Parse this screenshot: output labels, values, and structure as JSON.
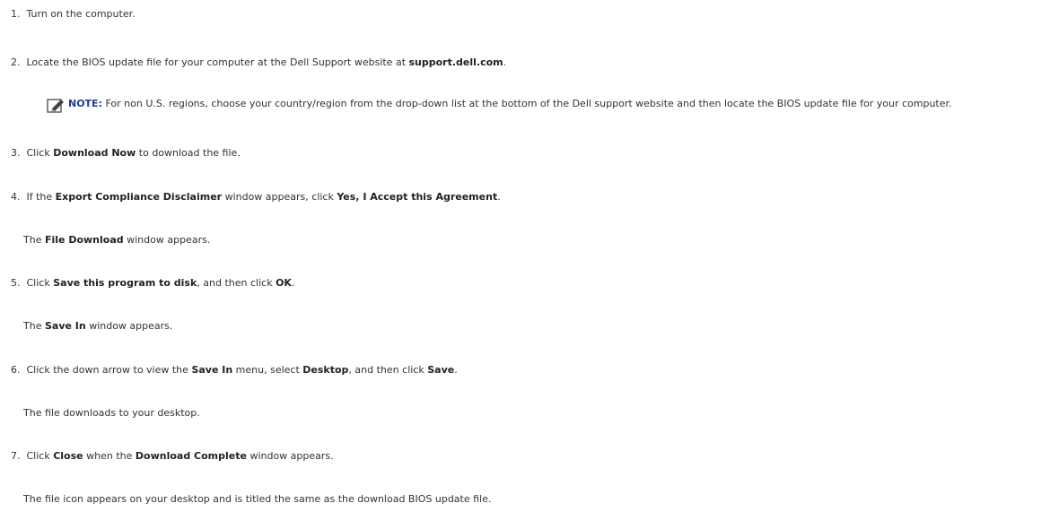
{
  "steps": {
    "s1": {
      "num": "1.",
      "text": "Turn on the computer."
    },
    "s2": {
      "num": "2.",
      "text_a": "Locate the BIOS update file for your computer at the Dell Support website at ",
      "bold_a": "support.dell.com",
      "text_b": "."
    },
    "note": {
      "label": "NOTE:",
      "text": " For non U.S. regions, choose your country/region from the drop-down list at the bottom of the Dell support website and then locate the BIOS update file for your computer."
    },
    "s3": {
      "num": "3.",
      "text_a": "Click ",
      "bold_a": "Download Now",
      "text_b": " to download the file."
    },
    "s4": {
      "num": "4.",
      "text_a": "If the ",
      "bold_a": "Export Compliance Disclaimer",
      "text_b": " window appears, click ",
      "bold_b": "Yes, I Accept this Agreement",
      "text_c": "."
    },
    "s4_sub": {
      "text_a": "The ",
      "bold_a": "File Download",
      "text_b": " window appears."
    },
    "s5": {
      "num": "5.",
      "text_a": "Click ",
      "bold_a": "Save this program to disk",
      "text_b": ", and then click ",
      "bold_b": "OK",
      "text_c": "."
    },
    "s5_sub": {
      "text_a": "The ",
      "bold_a": "Save In",
      "text_b": " window appears."
    },
    "s6": {
      "num": "6.",
      "text_a": "Click the down arrow to view the ",
      "bold_a": "Save In",
      "text_b": " menu, select ",
      "bold_b": "Desktop",
      "text_c": ", and then click ",
      "bold_c": "Save",
      "text_d": "."
    },
    "s6_sub": {
      "text": "The file downloads to your desktop."
    },
    "s7": {
      "num": "7.",
      "text_a": "Click ",
      "bold_a": "Close",
      "text_b": " when the ",
      "bold_b": "Download Complete",
      "text_c": " window appears."
    },
    "s7_sub": {
      "text": "The file icon appears on your desktop and is titled the same as the download BIOS update file."
    }
  },
  "icons": {
    "note": "pencil-note-icon"
  }
}
